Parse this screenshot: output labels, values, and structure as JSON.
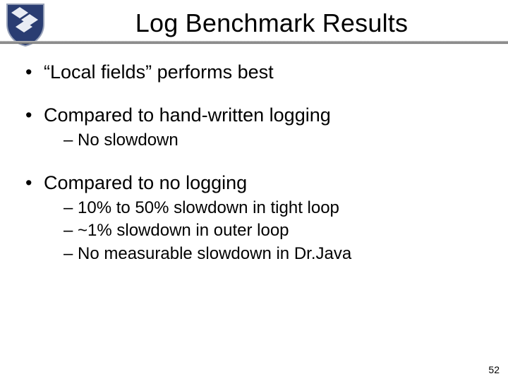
{
  "slide": {
    "title": "Log Benchmark Results",
    "page_number": "52",
    "bullets": [
      {
        "text": "“Local fields” performs best",
        "sub": []
      },
      {
        "text": "Compared to hand-written logging",
        "sub": [
          "No slowdown"
        ]
      },
      {
        "text": "Compared to no logging",
        "sub": [
          "10% to 50% slowdown in tight loop",
          "~1% slowdown in outer loop",
          "No measurable slowdown in Dr.Java"
        ]
      }
    ]
  },
  "logo": {
    "name": "shield-crest"
  }
}
